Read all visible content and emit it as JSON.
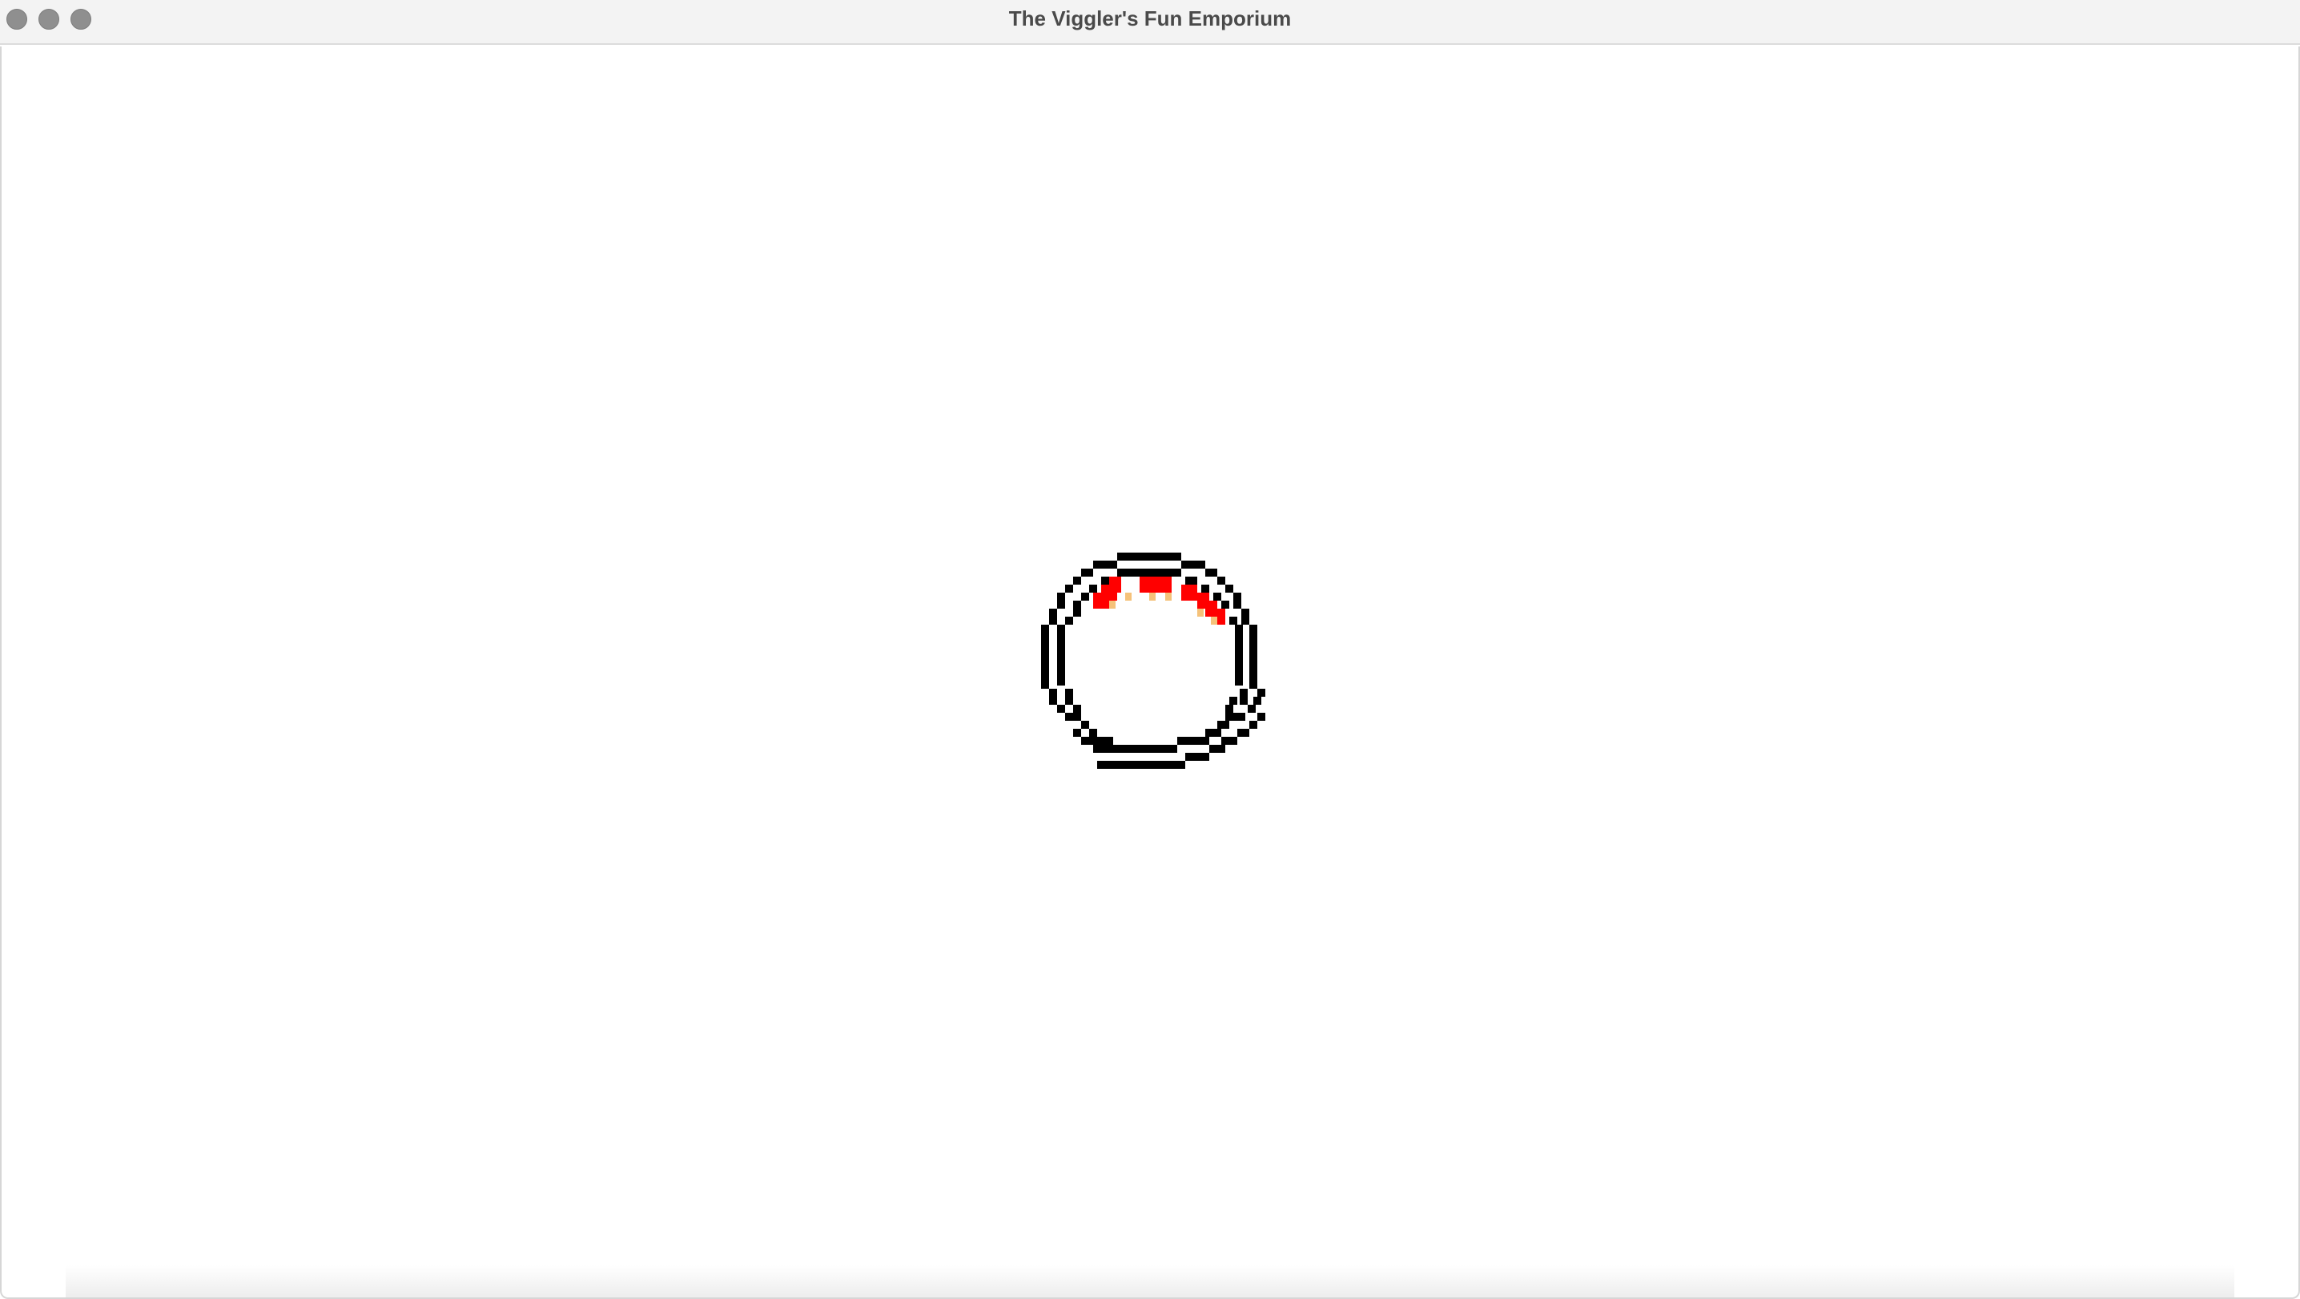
{
  "window": {
    "title": "The Viggler's Fun Emporium"
  },
  "titlebar_buttons": [
    {
      "name": "close",
      "icon": "close-circle-icon"
    },
    {
      "name": "minimize",
      "icon": "minimize-circle-icon"
    },
    {
      "name": "zoom",
      "icon": "zoom-circle-icon"
    }
  ],
  "sprite": {
    "icon": "pixel-ring-sprite-icon",
    "colors": {
      "outline": "#000000",
      "accent": "#ff0000",
      "highlight": "#f5c27a"
    }
  }
}
